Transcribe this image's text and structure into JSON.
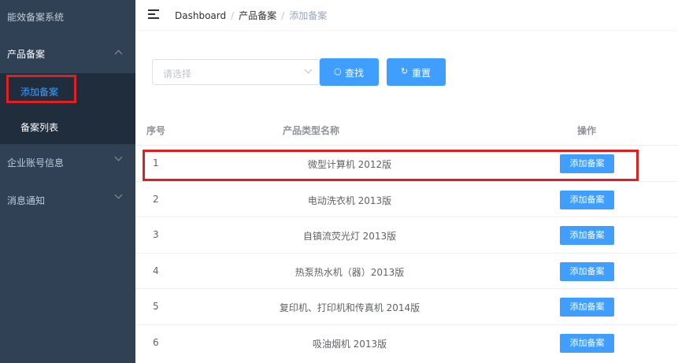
{
  "sidebar": {
    "title": "能效备案系统",
    "menus": [
      {
        "label": "产品备案",
        "expanded": true,
        "children": [
          {
            "label": "添加备案",
            "active": true
          },
          {
            "label": "备案列表",
            "active": false
          }
        ]
      },
      {
        "label": "企业账号信息",
        "expanded": false
      },
      {
        "label": "消息通知",
        "expanded": false
      }
    ]
  },
  "header": {
    "breadcrumb": [
      "Dashboard",
      "产品备案",
      "添加备案"
    ]
  },
  "filter": {
    "select_placeholder": "请选择",
    "search_label": "查找",
    "reset_label": "重置"
  },
  "table": {
    "columns": [
      "序号",
      "产品类型名称",
      "操作"
    ],
    "action_label": "添加备案",
    "rows": [
      {
        "index": "1",
        "name": "微型计算机 2012版"
      },
      {
        "index": "2",
        "name": "电动洗衣机 2013版"
      },
      {
        "index": "3",
        "name": "自镇流荧光灯 2013版"
      },
      {
        "index": "4",
        "name": "热泵热水机（器）2013版"
      },
      {
        "index": "5",
        "name": "复印机、打印机和传真机 2014版"
      },
      {
        "index": "6",
        "name": "吸油烟机 2013版"
      }
    ]
  },
  "colors": {
    "primary": "#409eff",
    "sidebar_bg": "#304156",
    "highlight": "#e02020"
  }
}
